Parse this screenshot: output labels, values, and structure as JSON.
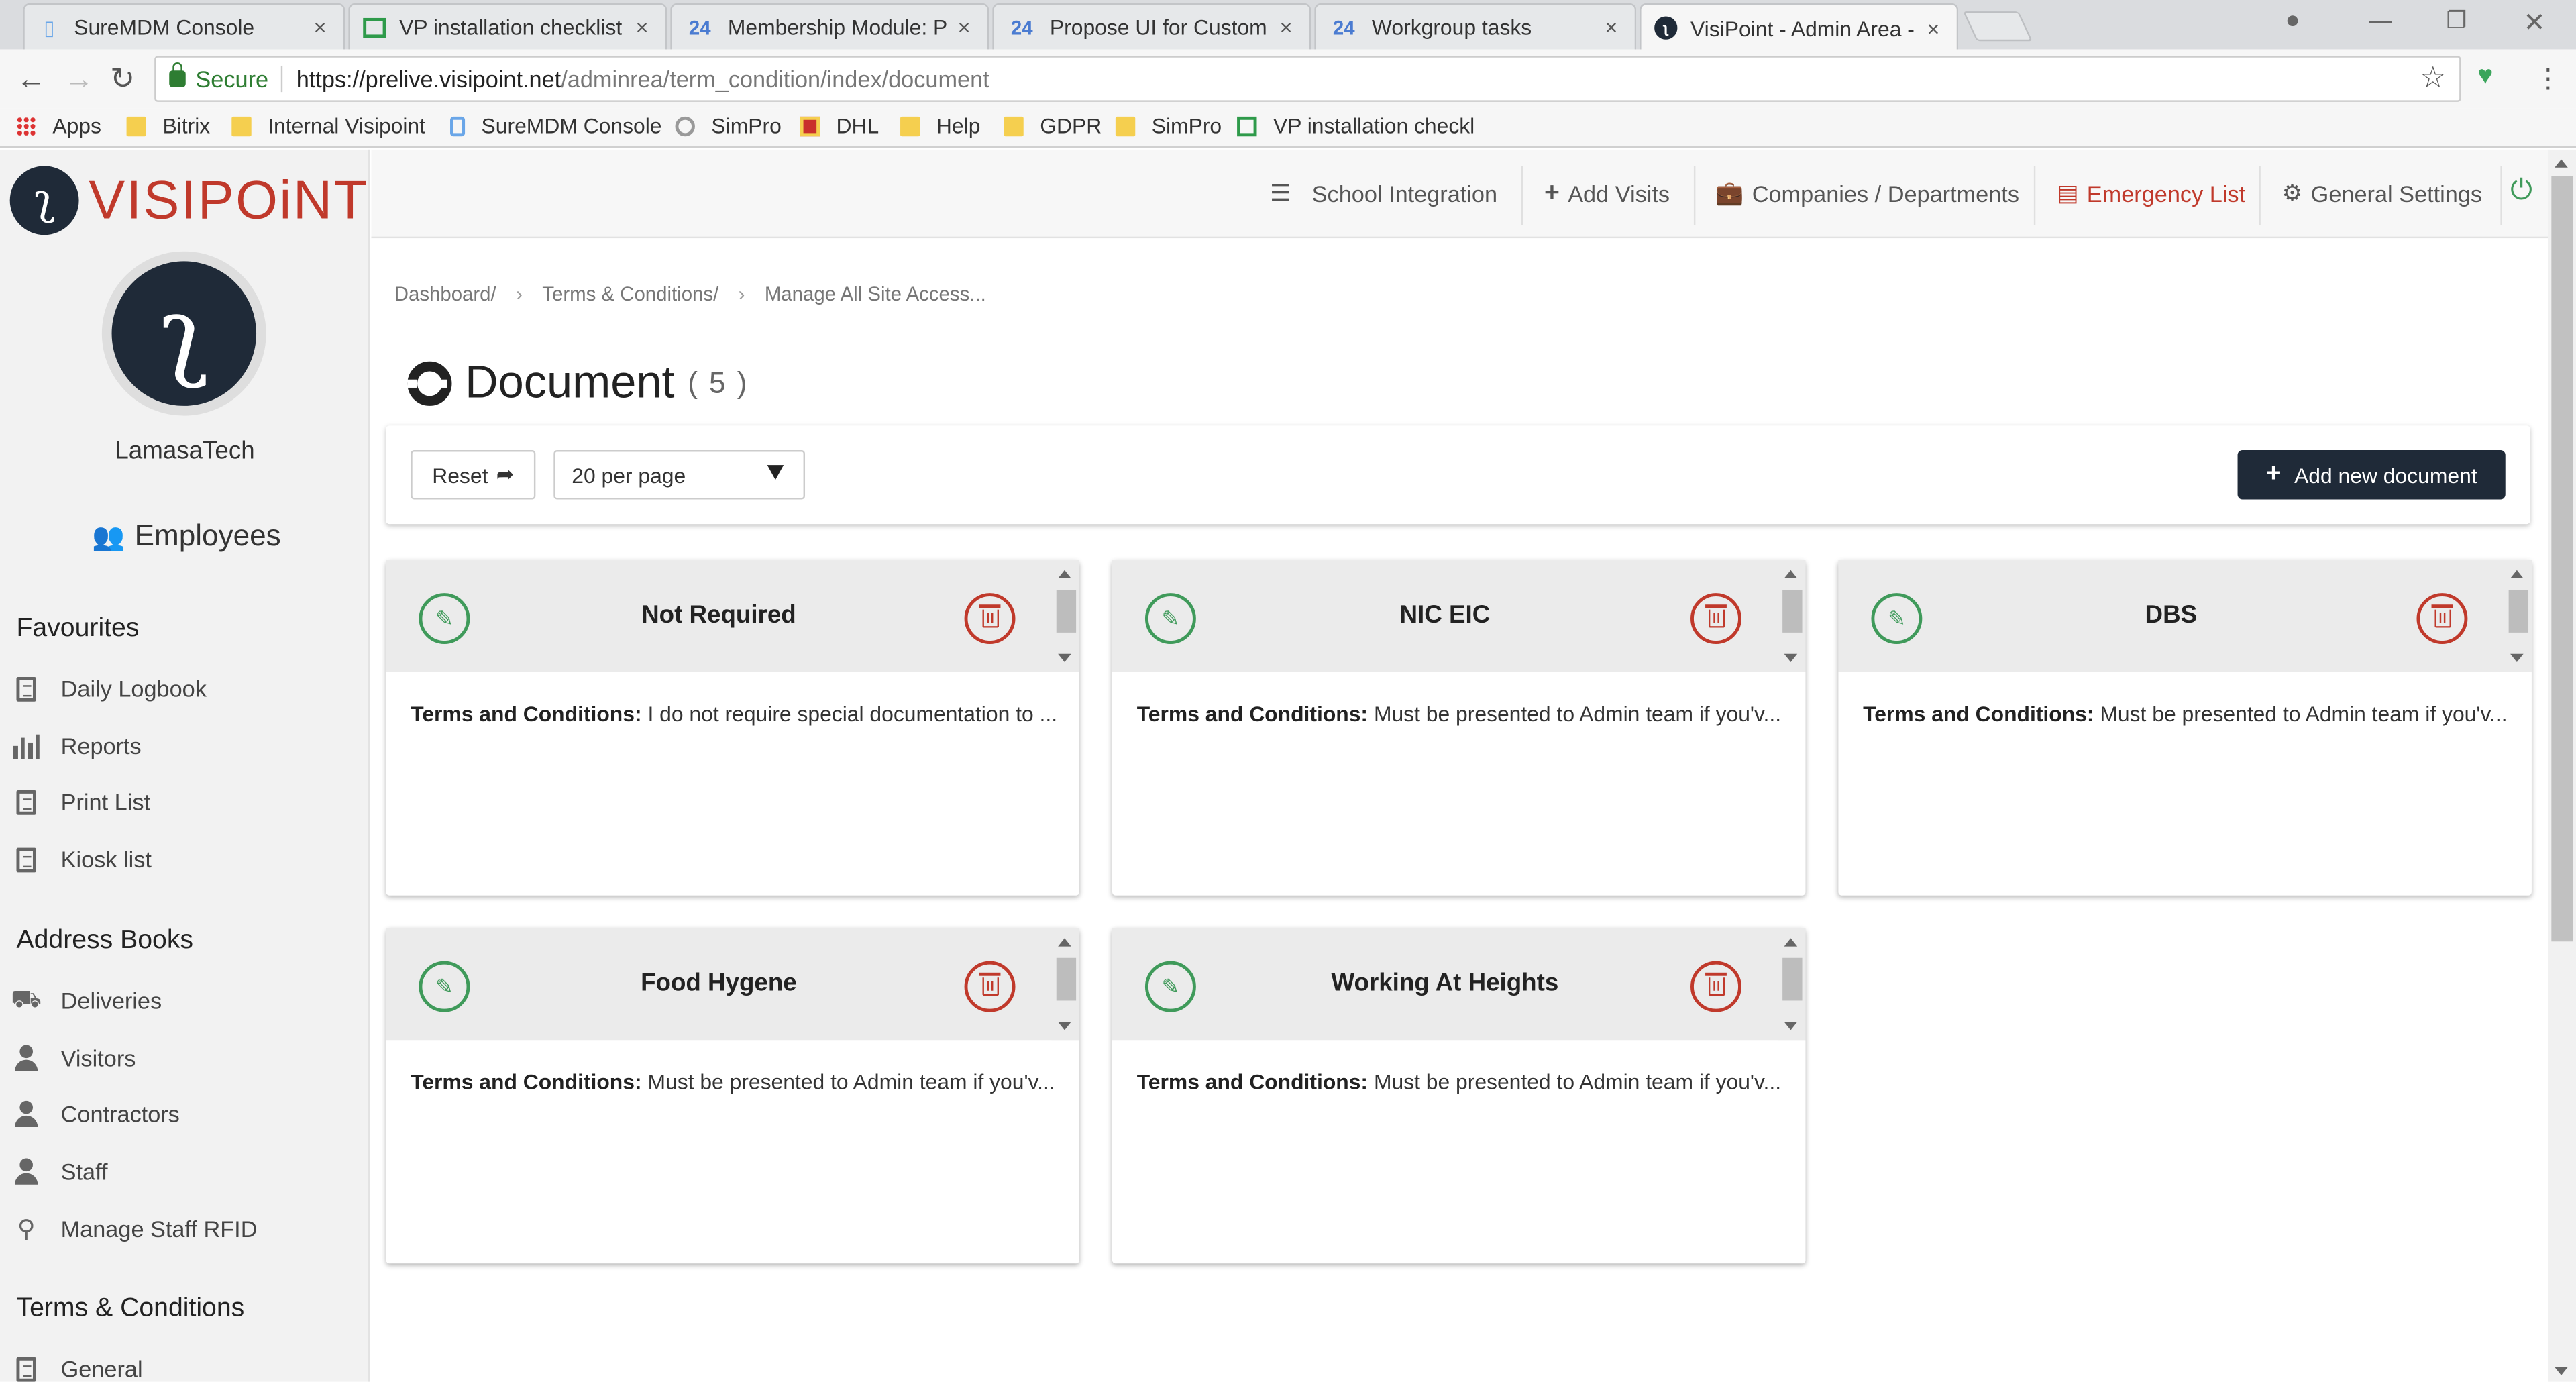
{
  "browser": {
    "tabs": [
      {
        "label": "SureMDM Console",
        "icon": "phone-icon",
        "close": "×"
      },
      {
        "label": "VP installation checklist -",
        "icon": "sheet-icon",
        "close": "×"
      },
      {
        "label": "Membership Module: PR",
        "icon": "24",
        "close": "×"
      },
      {
        "label": "Propose UI for Custom fi",
        "icon": "24",
        "close": "×"
      },
      {
        "label": "Workgroup tasks",
        "icon": "24",
        "close": "×"
      },
      {
        "label": "VisiPoint - Admin Area - ",
        "icon": "visipoint-icon",
        "close": "×"
      }
    ],
    "secure_label": "Secure",
    "url_host": "https://prelive.visipoint.net",
    "url_path": "/adminrea/term_condition/index/document",
    "bookmarks": [
      {
        "label": "Apps"
      },
      {
        "label": "Bitrix"
      },
      {
        "label": "Internal Visipoint"
      },
      {
        "label": "SureMDM Console"
      },
      {
        "label": "SimPro"
      },
      {
        "label": "DHL"
      },
      {
        "label": "Help"
      },
      {
        "label": "GDPR"
      },
      {
        "label": "SimPro"
      },
      {
        "label": "VP installation checkl"
      }
    ],
    "accent_colors": {
      "bookmark_folder": "#f5cf4f",
      "secure": "#2e7d32"
    }
  },
  "app": {
    "logo_text": "VISIPOiNT",
    "brand_color": "#c0392b",
    "dark_color": "#1f2a38",
    "user_name": "LamasaTech",
    "employees_label": "Employees"
  },
  "sidebar": {
    "favourites_title": "Favourites",
    "favourites": [
      {
        "label": "Daily Logbook",
        "icon": "document-icon"
      },
      {
        "label": "Reports",
        "icon": "bar-chart-icon"
      },
      {
        "label": "Print List",
        "icon": "document-icon"
      },
      {
        "label": "Kiosk list",
        "icon": "document-icon"
      }
    ],
    "address_books_title": "Address Books",
    "address_books": [
      {
        "label": "Deliveries",
        "icon": "truck-icon"
      },
      {
        "label": "Visitors",
        "icon": "user-icon"
      },
      {
        "label": "Contractors",
        "icon": "user-icon"
      },
      {
        "label": "Staff",
        "icon": "user-icon"
      },
      {
        "label": "Manage Staff RFID",
        "icon": "rfid-icon"
      }
    ],
    "terms_title": "Terms & Conditions",
    "terms": [
      {
        "label": "General",
        "icon": "document-icon"
      }
    ]
  },
  "topmenu": {
    "items": [
      {
        "label": "School Integration",
        "icon": "sliders-icon"
      },
      {
        "label": "Add Visits",
        "icon": "plus-icon"
      },
      {
        "label": "Companies / Departments",
        "icon": "briefcase-icon"
      },
      {
        "label": "Emergency List",
        "icon": "list-icon",
        "color": "#c0392b"
      },
      {
        "label": "General Settings",
        "icon": "gear-icon"
      }
    ],
    "power_icon": "power-icon"
  },
  "breadcrumb": [
    "Dashboard/",
    "Terms & Conditions/",
    "Manage All Site Access..."
  ],
  "page": {
    "title": "Document",
    "count": "( 5 )",
    "reset_label": "Reset",
    "per_page": "20 per page",
    "add_label": "Add new document"
  },
  "documents": [
    {
      "title": "Not Required",
      "terms_label": "Terms and Conditions:",
      "terms_text": "I do not require special documentation to ..."
    },
    {
      "title": "NIC EIC",
      "terms_label": "Terms and Conditions:",
      "terms_text": "Must be presented to Admin team if you'v..."
    },
    {
      "title": "DBS",
      "terms_label": "Terms and Conditions:",
      "terms_text": "Must be presented to Admin team if you'v..."
    },
    {
      "title": "Food Hygene",
      "terms_label": "Terms and Conditions:",
      "terms_text": "Must be presented to Admin team if you'v..."
    },
    {
      "title": "Working At Heights",
      "terms_label": "Terms and Conditions:",
      "terms_text": "Must be presented to Admin team if you'v..."
    }
  ]
}
